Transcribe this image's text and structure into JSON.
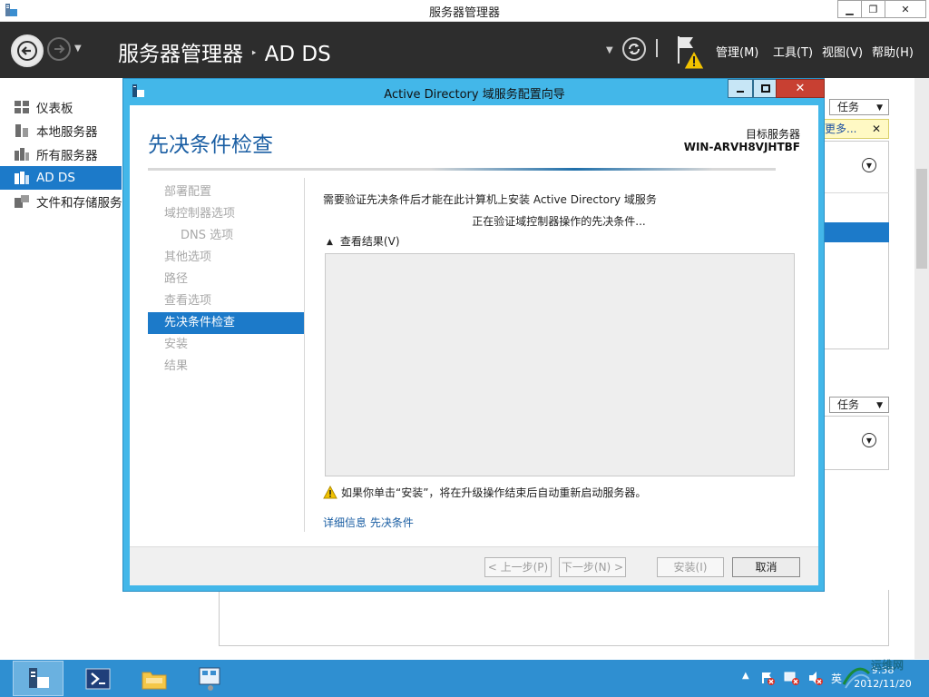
{
  "window": {
    "title": "服务器管理器",
    "min": "▁",
    "max": "❐",
    "close": "✕"
  },
  "header": {
    "breadcrumb_root": "服务器管理器",
    "breadcrumb_sep": "‣",
    "breadcrumb_current": "AD DS",
    "menus": [
      "管理(M)",
      "工具(T)",
      "视图(V)",
      "帮助(H)"
    ]
  },
  "nav": {
    "items": [
      {
        "label": "仪表板",
        "icon": "dashboard-icon",
        "selected": false
      },
      {
        "label": "本地服务器",
        "icon": "local-server-icon",
        "selected": false
      },
      {
        "label": "所有服务器",
        "icon": "all-servers-icon",
        "selected": false
      },
      {
        "label": "AD DS",
        "icon": "ad-ds-icon",
        "selected": true
      },
      {
        "label": "文件和存储服务",
        "icon": "file-storage-icon",
        "selected": false
      }
    ]
  },
  "background": {
    "tasks_label": "任务",
    "notice_text": "更多...",
    "notice_close": "✕"
  },
  "wizard": {
    "title": "Active Directory 域服务配置向导",
    "heading": "先决条件检查",
    "target_label": "目标服务器",
    "target_name": "WIN-ARVH8VJHTBF",
    "steps": [
      {
        "label": "部署配置",
        "sub": false,
        "active": false
      },
      {
        "label": "域控制器选项",
        "sub": false,
        "active": false
      },
      {
        "label": "DNS 选项",
        "sub": true,
        "active": false
      },
      {
        "label": "其他选项",
        "sub": false,
        "active": false
      },
      {
        "label": "路径",
        "sub": false,
        "active": false
      },
      {
        "label": "查看选项",
        "sub": false,
        "active": false
      },
      {
        "label": "先决条件检查",
        "sub": false,
        "active": true
      },
      {
        "label": "安装",
        "sub": false,
        "active": false
      },
      {
        "label": "结果",
        "sub": false,
        "active": false
      }
    ],
    "intro": "需要验证先决条件后才能在此计算机上安装 Active Directory 域服务",
    "progress": "正在验证域控制器操作的先决条件...",
    "view_results": "查看结果(V)",
    "warning": "如果你单击“安装”，将在升级操作结束后自动重新启动服务器。",
    "more_info": "详细信息 先决条件",
    "buttons": {
      "prev": "< 上一步(P)",
      "next": "下一步(N) >",
      "install": "安装(I)",
      "cancel": "取消"
    }
  },
  "taskbar": {
    "clock_time": "9:58",
    "clock_date": "2012/11/20",
    "ime": "英",
    "watermark": "运维网"
  },
  "colors": {
    "accent": "#1c7ac9",
    "wizard_frame": "#43b7e9",
    "header_bg": "#2d2d2d",
    "taskbar": "#2f8fd1",
    "warning": "#f2c200"
  }
}
